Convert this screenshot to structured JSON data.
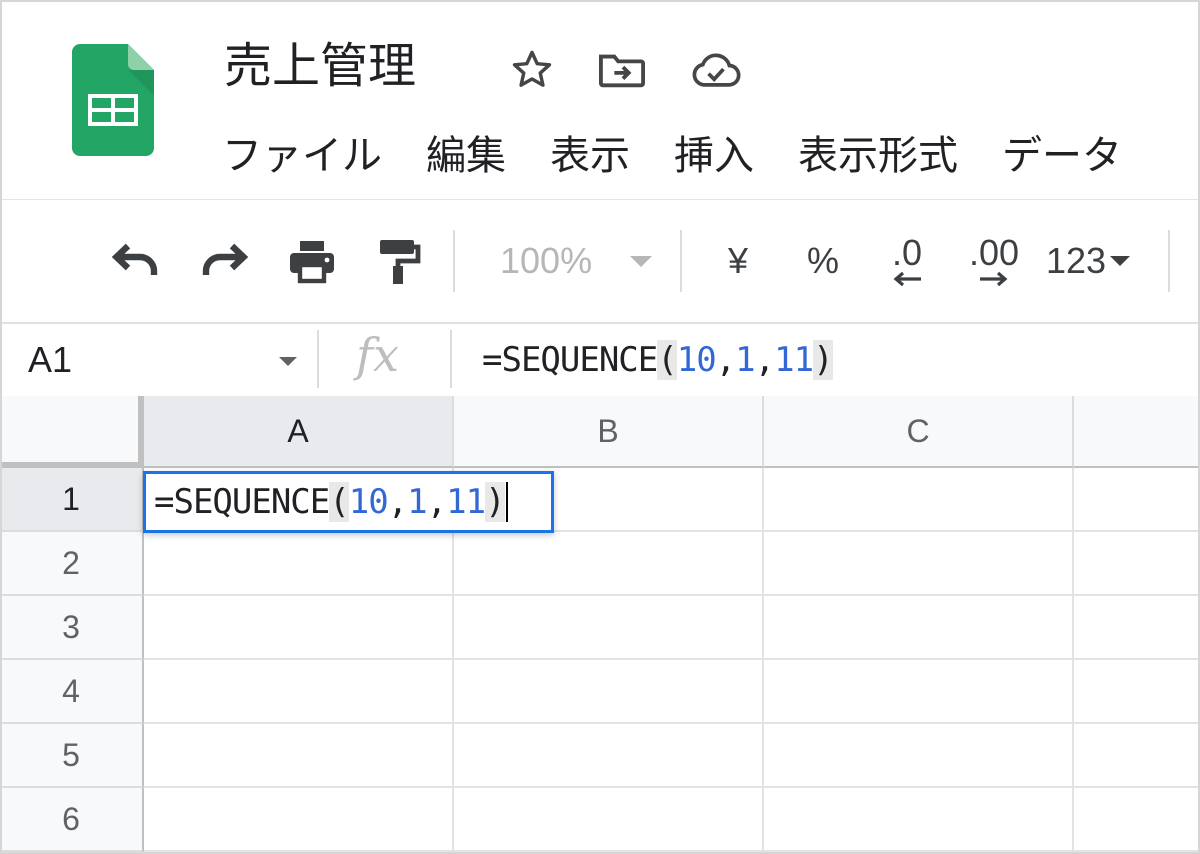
{
  "header": {
    "title": "売上管理",
    "icons": [
      "sheets-logo-icon",
      "star-icon",
      "move-to-folder-icon",
      "cloud-saved-icon"
    ],
    "menu": [
      "ファイル",
      "編集",
      "表示",
      "挿入",
      "表示形式",
      "データ"
    ]
  },
  "toolbar": {
    "icons": [
      "undo-icon",
      "redo-icon",
      "print-icon",
      "paint-format-icon"
    ],
    "zoom": "100%",
    "currency": "¥",
    "percent": "%",
    "decrease_decimal": ".0",
    "increase_decimal": ".00",
    "more_formats": "123"
  },
  "formula_bar": {
    "name_box": "A1",
    "fx": "fx",
    "formula": {
      "prefix": "=SEQUENCE",
      "open": "(",
      "arg1": "10",
      "arg2": "1",
      "arg3": "11",
      "comma": ",",
      "close": ")"
    }
  },
  "grid": {
    "columns": [
      "A",
      "B",
      "C"
    ],
    "rows": [
      "1",
      "2",
      "3",
      "4",
      "5",
      "6"
    ],
    "active_cell": "A1"
  },
  "colors": {
    "accent": "#1a73e8",
    "sheets_green": "#23a566",
    "number_blue": "#3367d6"
  }
}
